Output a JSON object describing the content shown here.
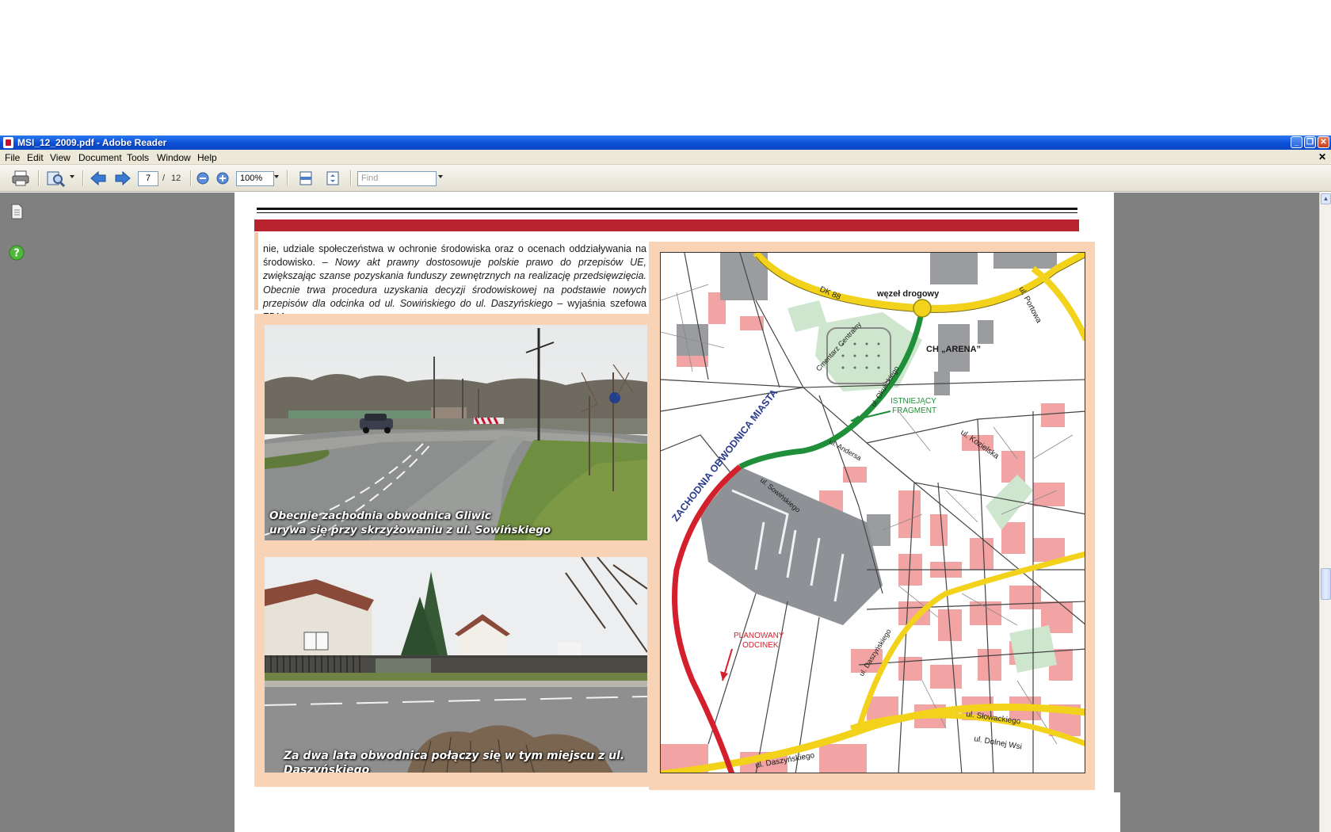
{
  "window": {
    "title": "MSI_12_2009.pdf - Adobe Reader",
    "menu": [
      "File",
      "Edit",
      "View",
      "Document",
      "Tools",
      "Window",
      "Help"
    ]
  },
  "toolbar": {
    "current_page": "7",
    "total_pages": "12",
    "zoom": "100%",
    "find_placeholder": "Find"
  },
  "colors": {
    "titlebar": "#0a4fd6",
    "accent_red": "#b8232f",
    "peach": "#f9d3b6",
    "route_green": "#1f8f3a",
    "route_red": "#d4202c",
    "road_yellow": "#f2d21b"
  },
  "article": {
    "text_normal_1": "nie, udziale społeczeństwa w ochronie środowiska oraz o ocenach oddziaływania na środowisko. – ",
    "text_italic": "Nowy akt prawny dostosowuje polskie prawo do przepisów UE, zwiększając szanse pozyskania funduszy zewnętrznych na realizację przedsięwzięcia. Obecnie trwa procedura uzyskania decyzji środowiskowej na podstawie nowych przepisów dla odcinka od ul. Sowińskiego do ul. Daszyńskiego",
    "text_normal_2": " – wyjaśnia szefowa ZDM.",
    "photo1_caption_line1": "Obecnie zachodnia obwodnica Gliwic",
    "photo1_caption_line2": "urywa się przy skrzyżowaniu z ul. Sowińskiego",
    "photo2_caption": "Za dwa lata obwodnica połączy się w tym miejscu z ul. Daszyńskiego"
  },
  "map": {
    "labels": {
      "dk88": "DK 88",
      "wezel": "węzeł drogowy",
      "portowa": "ul. Portowa",
      "cmentarz": "Cmentarz Centralny",
      "arena": "CH „ARENA”",
      "okulickiego": "ul. Okulickiego",
      "istniejacy_1": "ISTNIEJĄCY",
      "istniejacy_2": "FRAGMENT",
      "kozielska": "ul. Kozielska",
      "andersa": "ul. Andersa",
      "zachodnia": "ZACHODNIA OBWODNICA MIASTA",
      "sowinskiego": "ul. Sowińskiego",
      "planowany_1": "PLANOWANY",
      "planowany_2": "ODCINEK",
      "daszynskiego_diag": "ul. Daszyńskiego",
      "slowackiego": "ul. Słowackiego",
      "dolnej_wsi": "ul. Dolnej Wsi",
      "daszynskiego_bottom": "ul. Daszyńskiego"
    }
  }
}
